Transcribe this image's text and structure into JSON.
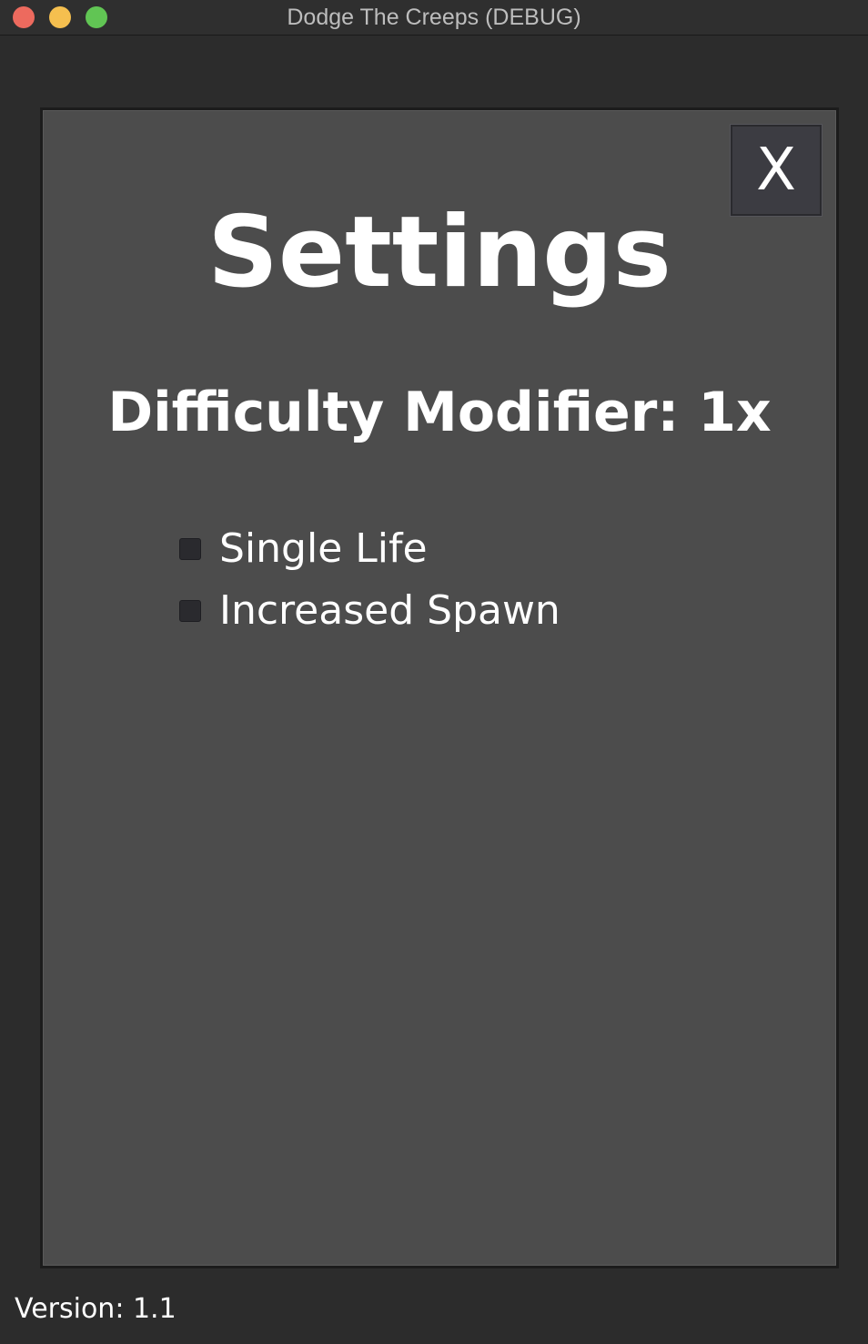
{
  "window": {
    "title": "Dodge The Creeps (DEBUG)"
  },
  "settings": {
    "heading": "Settings",
    "close_label": "X",
    "difficulty_text": "Difficulty Modifier: 1x",
    "options": [
      {
        "label": "Single Life",
        "checked": false
      },
      {
        "label": "Increased Spawn",
        "checked": false
      }
    ]
  },
  "footer": {
    "version": "Version: 1.1"
  },
  "colors": {
    "background": "#2c2c2c",
    "panel": "#4c4c4c",
    "close_button": "#3c3c42",
    "text": "#ffffff"
  }
}
